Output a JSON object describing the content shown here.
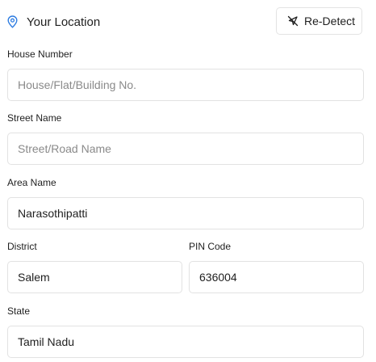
{
  "header": {
    "title": "Your Location",
    "location_icon": "map-pin-icon",
    "redetect": {
      "label": "Re-Detect",
      "icon": "location-crosshair-off-icon"
    }
  },
  "form": {
    "house_number": {
      "label": "House Number",
      "value": "",
      "placeholder": "House/Flat/Building No."
    },
    "street_name": {
      "label": "Street Name",
      "value": "",
      "placeholder": "Street/Road Name"
    },
    "area_name": {
      "label": "Area Name",
      "value": "Narasothipatti",
      "placeholder": ""
    },
    "district": {
      "label": "District",
      "value": "Salem",
      "placeholder": ""
    },
    "pin_code": {
      "label": "PIN Code",
      "value": "636004",
      "placeholder": ""
    },
    "state": {
      "label": "State",
      "value": "Tamil Nadu",
      "placeholder": ""
    }
  },
  "colors": {
    "accent": "#2f7de1",
    "border": "#e2e2e2",
    "text": "#1f1f1f",
    "placeholder": "#8a8a8a"
  }
}
